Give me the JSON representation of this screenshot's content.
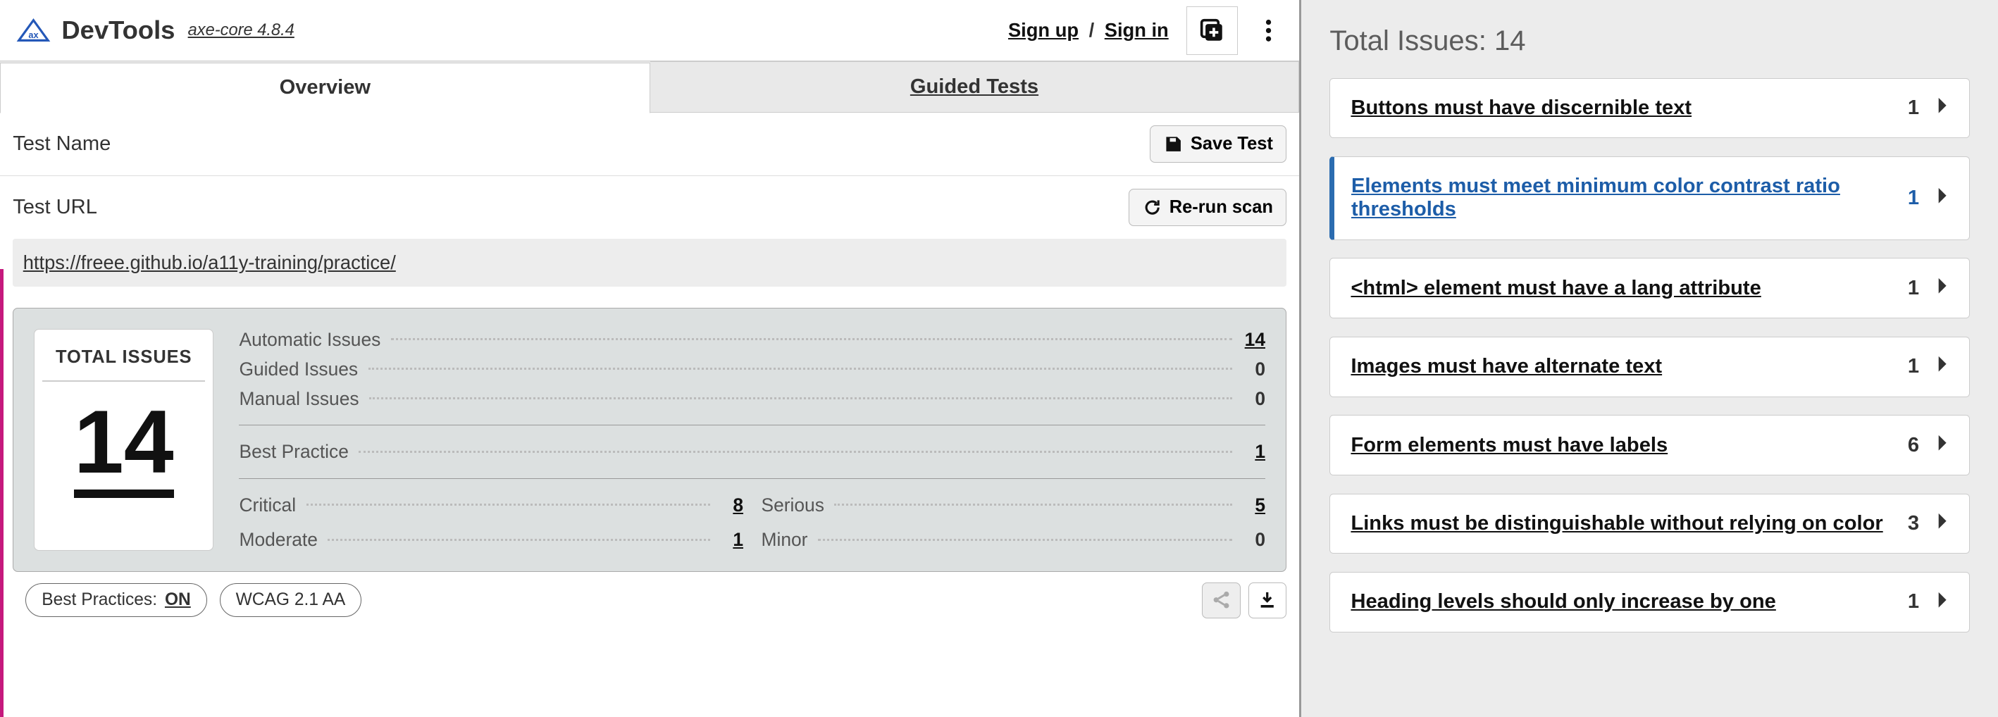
{
  "header": {
    "app_title": "DevTools",
    "app_subtitle": "axe-core 4.8.4",
    "sign_up": "Sign up",
    "separator": "/",
    "sign_in": "Sign in"
  },
  "tabs": {
    "overview": "Overview",
    "guided": "Guided Tests"
  },
  "overview": {
    "test_name_label": "Test Name",
    "save_test_btn": "Save Test",
    "test_url_label": "Test URL",
    "rerun_btn": "Re-run scan",
    "url": "https://freee.github.io/a11y-training/practice/"
  },
  "summary": {
    "total_issues_label": "TOTAL ISSUES",
    "total_issues_value": "14",
    "group1": [
      {
        "label": "Automatic Issues",
        "value": "14",
        "link": true
      },
      {
        "label": "Guided Issues",
        "value": "0",
        "link": false
      },
      {
        "label": "Manual Issues",
        "value": "0",
        "link": false
      }
    ],
    "group2": [
      {
        "label": "Best Practice",
        "value": "1",
        "link": true
      }
    ],
    "group3a": [
      {
        "label": "Critical",
        "value": "8",
        "link": true
      },
      {
        "label": "Serious",
        "value": "5",
        "link": true
      }
    ],
    "group3b": [
      {
        "label": "Moderate",
        "value": "1",
        "link": true
      },
      {
        "label": "Minor",
        "value": "0",
        "link": false
      }
    ]
  },
  "chips": {
    "bp_label": "Best Practices:",
    "bp_value": "ON",
    "wcag": "WCAG 2.1 AA"
  },
  "issues_panel": {
    "title": "Total Issues: 14",
    "items": [
      {
        "title": "Buttons must have discernible text",
        "count": "1",
        "highlight": false
      },
      {
        "title": "Elements must meet minimum color contrast ratio thresholds",
        "count": "1",
        "highlight": true
      },
      {
        "title": "<html> element must have a lang attribute",
        "count": "1",
        "highlight": false
      },
      {
        "title": "Images must have alternate text",
        "count": "1",
        "highlight": false
      },
      {
        "title": "Form elements must have labels",
        "count": "6",
        "highlight": false
      },
      {
        "title": "Links must be distinguishable without relying on color",
        "count": "3",
        "highlight": false
      },
      {
        "title": "Heading levels should only increase by one",
        "count": "1",
        "highlight": false
      }
    ]
  }
}
